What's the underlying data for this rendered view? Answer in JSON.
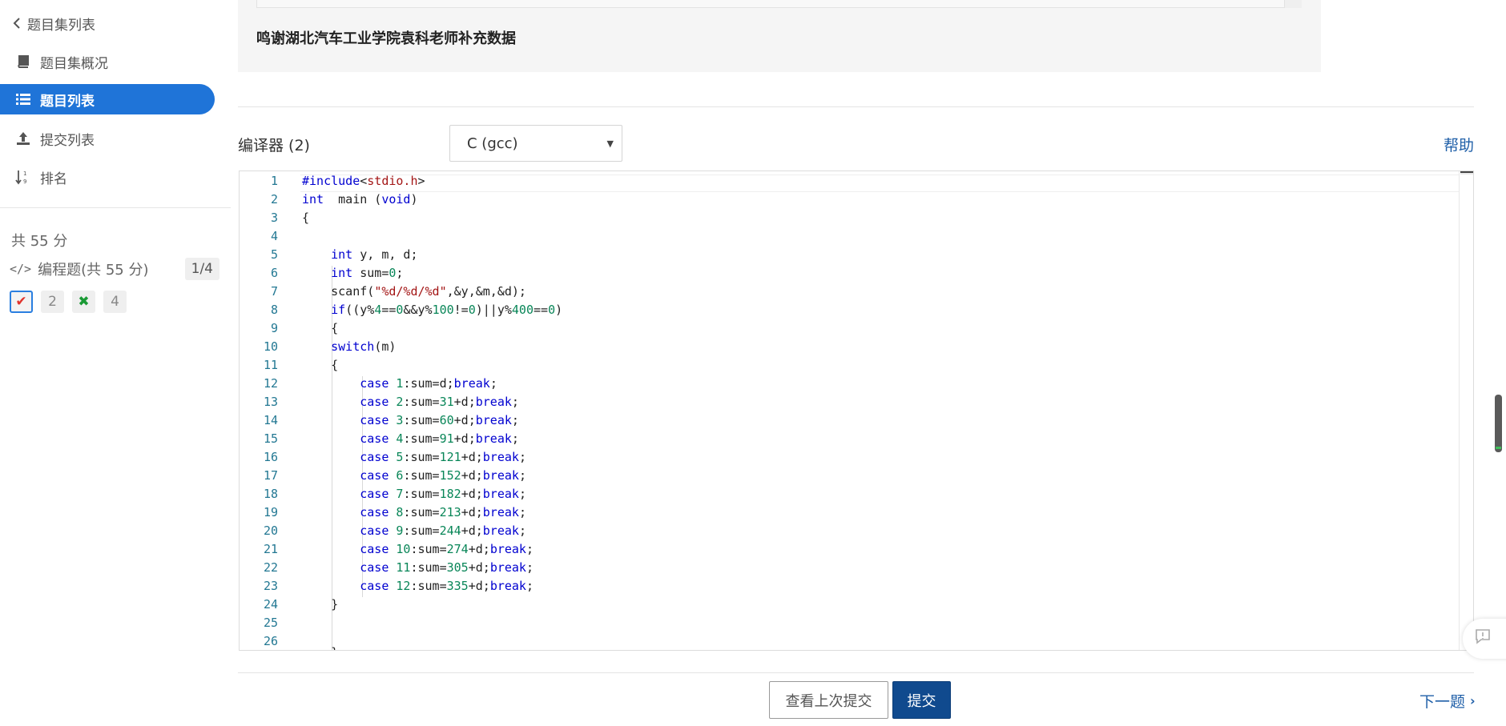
{
  "sidebar": {
    "back_label": "题目集列表",
    "items": [
      {
        "label": "题目集概况",
        "icon": "book-icon"
      },
      {
        "label": "题目列表",
        "icon": "list-icon",
        "active": true
      },
      {
        "label": "提交列表",
        "icon": "upload-icon"
      },
      {
        "label": "排名",
        "icon": "sort-icon"
      }
    ],
    "total_score": "共 55 分",
    "section": {
      "label": "编程题(共 55 分)",
      "progress": "1/4"
    },
    "questions": [
      {
        "label": "✔",
        "state": "accepted-current"
      },
      {
        "label": "2",
        "state": "unanswered"
      },
      {
        "label": "✖",
        "state": "wrong"
      },
      {
        "label": "4",
        "state": "unanswered"
      }
    ]
  },
  "problem": {
    "note": "鸣谢湖北汽车工业学院袁科老师补充数据"
  },
  "compiler": {
    "label": "编译器 (2)",
    "selected": "C (gcc)",
    "help_label": "帮助"
  },
  "editor": {
    "line_numbers": [
      "1",
      "2",
      "3",
      "4",
      "5",
      "6",
      "7",
      "8",
      "9",
      "10",
      "11",
      "12",
      "13",
      "14",
      "15",
      "16",
      "17",
      "18",
      "19",
      "20",
      "21",
      "22",
      "23",
      "24",
      "25",
      "26"
    ]
  },
  "footer": {
    "view_last_label": "查看上次提交",
    "submit_label": "提交",
    "next_label": "下一题"
  },
  "colors": {
    "accent": "#1f74d8",
    "submit": "#104a8e",
    "link": "#1f5fa8",
    "accepted": "#e0332c",
    "wrong": "#1a9a35"
  }
}
